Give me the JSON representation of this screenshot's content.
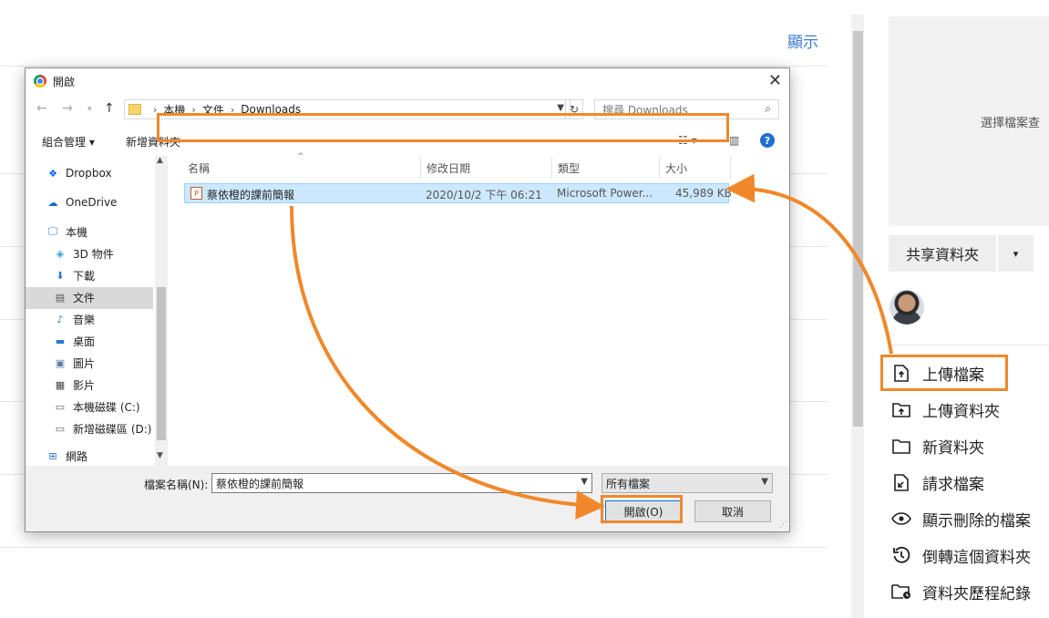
{
  "background": {
    "show_link": "顯示",
    "preview_text": "選擇檔案查",
    "share_folder": "共享資料夾",
    "share_caret": "▾",
    "menu": [
      {
        "label": "上傳檔案",
        "icon": "upload-file-icon"
      },
      {
        "label": "上傳資料夾",
        "icon": "upload-folder-icon"
      },
      {
        "label": "新資料夾",
        "icon": "new-folder-icon"
      },
      {
        "label": "請求檔案",
        "icon": "request-file-icon"
      },
      {
        "label": "顯示刪除的檔案",
        "icon": "eye-icon"
      },
      {
        "label": "倒轉這個資料夾",
        "icon": "rewind-icon"
      },
      {
        "label": "資料夾歷程紀錄",
        "icon": "folder-history-icon"
      }
    ]
  },
  "dialog": {
    "title": "開啟",
    "breadcrumb": [
      "本機",
      "文件",
      "Downloads"
    ],
    "search_placeholder": "搜尋 Downloads",
    "toolbar": {
      "organize": "組合管理",
      "organize_caret": "▾",
      "new_folder": "新增資料夾"
    },
    "nav_items": [
      {
        "label": "Dropbox",
        "icon": "dropbox-icon"
      },
      {
        "label": "OneDrive",
        "icon": "onedrive-icon"
      },
      {
        "label": "本機",
        "icon": "computer-icon"
      },
      {
        "label": "3D 物件",
        "icon": "3d-objects-icon"
      },
      {
        "label": "下載",
        "icon": "download-icon"
      },
      {
        "label": "文件",
        "icon": "documents-icon",
        "selected": true
      },
      {
        "label": "音樂",
        "icon": "music-icon"
      },
      {
        "label": "桌面",
        "icon": "desktop-icon"
      },
      {
        "label": "圖片",
        "icon": "pictures-icon"
      },
      {
        "label": "影片",
        "icon": "videos-icon"
      },
      {
        "label": "本機磁碟 (C:)",
        "icon": "drive-c-icon"
      },
      {
        "label": "新增磁碟區 (D:)",
        "icon": "drive-d-icon"
      },
      {
        "label": "網路",
        "icon": "network-icon"
      }
    ],
    "columns": [
      "名稱",
      "修改日期",
      "類型",
      "大小"
    ],
    "files": [
      {
        "name": "蔡依橙的課前簡報",
        "modified": "2020/10/2 下午 06:21",
        "type": "Microsoft Power...",
        "size": "45,989 KB"
      }
    ],
    "filename_label": "檔案名稱(N):",
    "filename_value": "蔡依橙的課前簡報",
    "filetype": "所有檔案",
    "open_button": "開啟(O)",
    "cancel_button": "取消"
  },
  "colors": {
    "highlight": "#f0882b",
    "selection": "#cce8ff",
    "link": "#3a7bd5"
  }
}
